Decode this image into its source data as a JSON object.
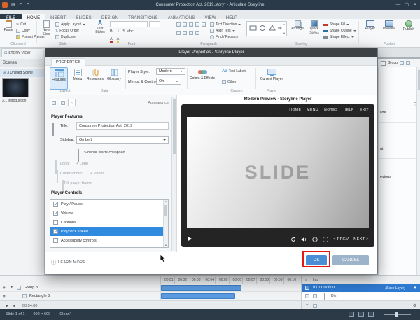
{
  "icons": {
    "minimize": "—",
    "maximize": "▢",
    "close": "✕",
    "save": "▤",
    "undo": "↶",
    "redo": "↷",
    "scissors": "✂",
    "check": "✓",
    "play": "▶",
    "stop": "■",
    "info": "ⓘ",
    "gear": "⚙",
    "eye": "◉",
    "expander": "▸",
    "grid": "⊞",
    "lines": "≡",
    "aa": "Aa",
    "letter_a": "A",
    "minus": "−",
    "plus": "+",
    "up": "▲",
    "down": "▼",
    "updown": "⇅"
  },
  "titlebar": {
    "title": "Consumer Protection Act, 2019.story* - Articulate Storyline"
  },
  "ribbon_tabs": [
    {
      "label": "FILE"
    },
    {
      "label": "HOME"
    },
    {
      "label": "INSERT"
    },
    {
      "label": "SLIDES"
    },
    {
      "label": "DESIGN"
    },
    {
      "label": "TRANSITIONS"
    },
    {
      "label": "ANIMATIONS"
    },
    {
      "label": "VIEW"
    },
    {
      "label": "HELP"
    }
  ],
  "ribbon": {
    "clipboard": {
      "label": "Clipboard",
      "paste": "Paste",
      "cut": "Cut",
      "copy": "Copy",
      "format_painter": "Format Painter"
    },
    "slide": {
      "label": "Slide",
      "new_slide": "New Slide",
      "apply_layout": "Apply Layout",
      "focus_order": "Focus Order",
      "duplicate": "Duplicate"
    },
    "font": {
      "label": "Font",
      "text_styles": "Text Styles",
      "styles": [
        "B",
        "I",
        "U",
        "S",
        "abc"
      ]
    },
    "paragraph": {
      "label": "Paragraph",
      "text_direction": "Text Direction",
      "align_text": "Align Text",
      "find_replace": "Find / Replace"
    },
    "drawing": {
      "label": "Drawing",
      "arrange": "Arrange",
      "quick_styles": "Quick Styles",
      "shape_fill": "Shape Fill",
      "shape_outline": "Shape Outline",
      "shape_effect": "Shape Effect"
    },
    "publish": {
      "label": "Publish",
      "player": "Player",
      "preview": "Preview",
      "publish": "Publish"
    }
  },
  "workspace": {
    "story_view_tab": "STORY VIEW",
    "scenes_header": "Scenes",
    "scene_item": "3 Untitled Scene",
    "slide_thumb_label": "3.1 Introduction",
    "group_row_label": "Group",
    "clip1": "lide",
    "clip2": "nt",
    "clip3": "evious"
  },
  "dialog": {
    "title": "Player Properties - Storyline Player",
    "tab_properties": "PROPERTIES",
    "ribbon": {
      "features": "Features",
      "menu": "Menu",
      "resources": "Resources",
      "glossary": "Glossary",
      "player_style_label": "Player Style:",
      "player_style_value": "Modern",
      "menus_controls_label": "Menus & Controls:",
      "menus_controls_value": "On",
      "colors_effects": "Colors & Effects",
      "text_labels": "Text Labels",
      "other": "Other",
      "current_player": "Current Player",
      "groups": {
        "layout": "Layout",
        "data": "Data",
        "custom": "Custom",
        "player": "Player"
      }
    },
    "pane_toolbar_label": "Appearance",
    "features_section": {
      "header": "Player Features",
      "title_label": "Title:",
      "title_value": "Consumer Protection Act, 2019",
      "sidebar_label": "Sidebar:",
      "sidebar_value": "On Left",
      "sidebar_collapsed_label": "Sidebar starts collapsed",
      "logo_label": "Logo:",
      "logo_add": "+ Logo",
      "cover_label": "Cover Photo:",
      "cover_add": "+ Photo",
      "fill_frame_label": "Fill player frame"
    },
    "controls_section": {
      "header": "Player Controls",
      "items": [
        {
          "label": "Play / Pause",
          "checked": true,
          "selected": false
        },
        {
          "label": "Volume",
          "checked": true,
          "selected": false
        },
        {
          "label": "Captions",
          "checked": false,
          "selected": false
        },
        {
          "label": "Playback speed",
          "checked": true,
          "selected": true
        },
        {
          "label": "Accessibility controls",
          "checked": false,
          "selected": false
        }
      ]
    },
    "preview": {
      "header": "Modern Preview - Storyline Player",
      "menu_items": [
        "HOME",
        "MENU",
        "NOTES",
        "HELP",
        "EXIT"
      ],
      "slide_placeholder": "SLIDE",
      "prev_label": "< PREV",
      "next_label": "NEXT >"
    },
    "footer": {
      "learn_more": "LEARN MORE...",
      "ok": "OK",
      "cancel": "CANCEL"
    }
  },
  "timeline": {
    "times": [
      "00:01",
      "00:02",
      "00:03",
      "00:04",
      "00:05",
      "00:06",
      "00:07",
      "00:08",
      "00:09",
      "00:10"
    ],
    "rows": [
      {
        "name": "Group 8"
      },
      {
        "name": "Rectangle 5"
      }
    ],
    "time_display": "00:54:00"
  },
  "layers_panel": {
    "header_clipped": "Intu",
    "base_layer_name": "Introduction",
    "base_layer_suffix": "(Base Layer)",
    "dim_label": "Dim"
  },
  "statusbar": {
    "slide_info": "Slide 1 of 1",
    "dimensions": "990 × 600",
    "theme": "'Clean'"
  }
}
